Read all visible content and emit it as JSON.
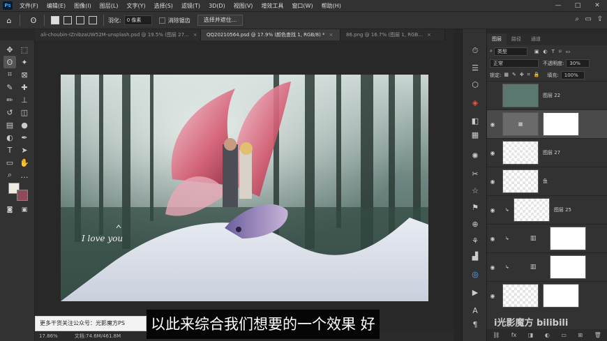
{
  "app": {
    "logo": "Ps"
  },
  "menu": [
    "文件(F)",
    "编辑(E)",
    "图像(I)",
    "图层(L)",
    "文字(Y)",
    "选择(S)",
    "滤镜(T)",
    "3D(D)",
    "视图(V)",
    "增效工具",
    "窗口(W)",
    "帮助(H)"
  ],
  "options": {
    "feather_label": "羽化:",
    "feather_value": "0 像素",
    "antialias_label": "消除锯齿",
    "select_mask_button": "选择并遮住..."
  },
  "tabs": [
    {
      "label": "ali-choubin-IZnibzaUW52M-unsplash.psd @ 19.5% (图层 27...",
      "close": "×"
    },
    {
      "label": "QQ20210564.psd @ 17.9% (颜色查找 1, RGB/8) *",
      "close": "×"
    },
    {
      "label": "86.png @ 16.7% (图层 1, RGB...",
      "close": "×"
    }
  ],
  "canvas": {
    "overlay_text": "I love you"
  },
  "status": {
    "zoom": "17.86%",
    "doc_info": "文档:74.6M/461.8M"
  },
  "watermark_box": "更多干货关注公众号：光影魔方PS",
  "subtitle": "以此来综合我们想要的一个效果 好",
  "brand_watermark": "i光影魔方 bilibili",
  "layers_panel": {
    "tabs": [
      "图层",
      "路径",
      "通道"
    ],
    "filter_kind": "类型",
    "blend_mode": "正常",
    "opacity_label": "不透明度:",
    "opacity_value": "30%",
    "lock_label": "锁定:",
    "fill_label": "填充:",
    "fill_value": "100%",
    "layers": [
      {
        "name": "图层 22",
        "visible": false
      },
      {
        "name": "",
        "visible": true
      },
      {
        "name": "图层 27",
        "visible": true
      },
      {
        "name": "鱼",
        "visible": true
      },
      {
        "name": "图层 25",
        "visible": true
      },
      {
        "name": "",
        "visible": true
      },
      {
        "name": "",
        "visible": true
      },
      {
        "name": "",
        "visible": true
      }
    ],
    "bottom_icons": [
      "fx"
    ]
  },
  "colors": {
    "foreground": "#f1ebe2",
    "background": "#8f4a5c"
  }
}
